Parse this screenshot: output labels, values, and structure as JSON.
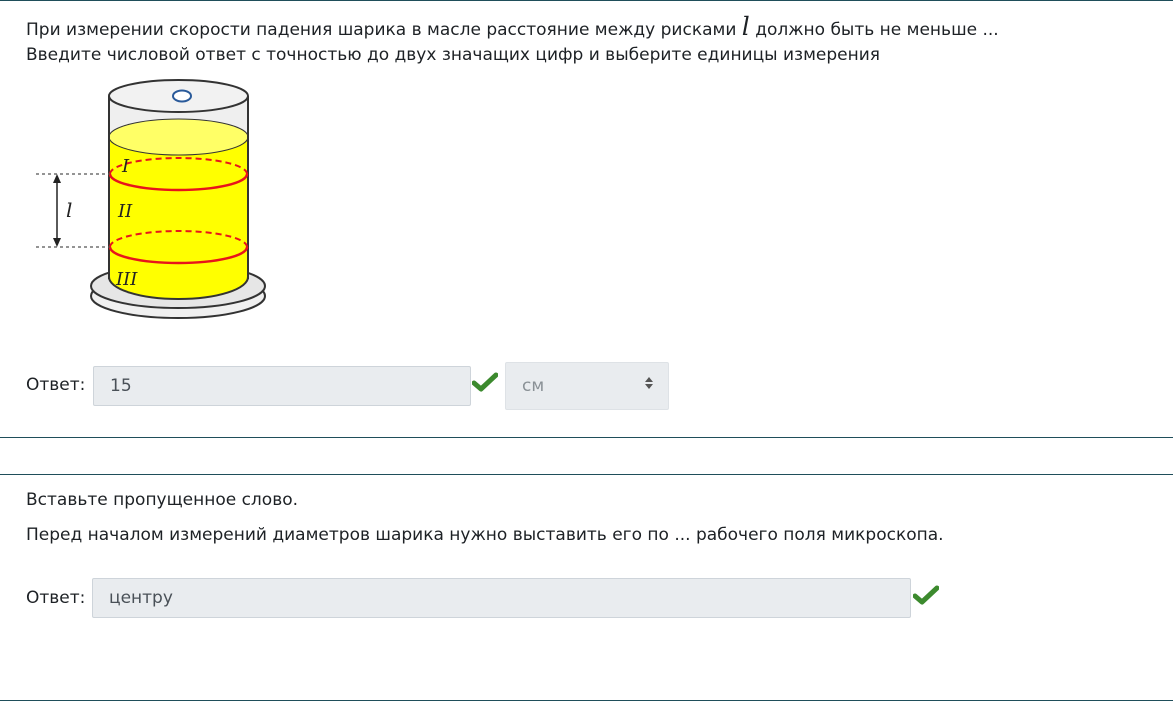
{
  "question1": {
    "text_line1_part1": "При измерении скорости падения шарика в масле расстояние между рисками",
    "variable": "l",
    "text_line1_part2": "должно быть не меньше  ...",
    "text_line2": "Введите числовой ответ с точностью до двух значащих цифр и  выберите  единицы измерения",
    "figure": {
      "label_I": "I",
      "label_II": "II",
      "label_III": "III",
      "label_l": "l",
      "liquid_color": "#ffff00",
      "mark_color": "#e8141b"
    },
    "answer_label": "Ответ:",
    "answer_value": "15",
    "unit_selected": "см",
    "correct_icon": "check-icon"
  },
  "question2": {
    "instruction": "Вставьте пропущенное слово.",
    "text": "Перед началом измерений диаметров шарика нужно выставить его по ... рабочего поля микроскопа.",
    "answer_label": "Ответ:",
    "answer_value": "центру",
    "correct_icon": "check-icon"
  },
  "colors": {
    "check": "#3c8a2e",
    "separator": "#1f4e5a",
    "input_bg": "#e9ecef"
  }
}
